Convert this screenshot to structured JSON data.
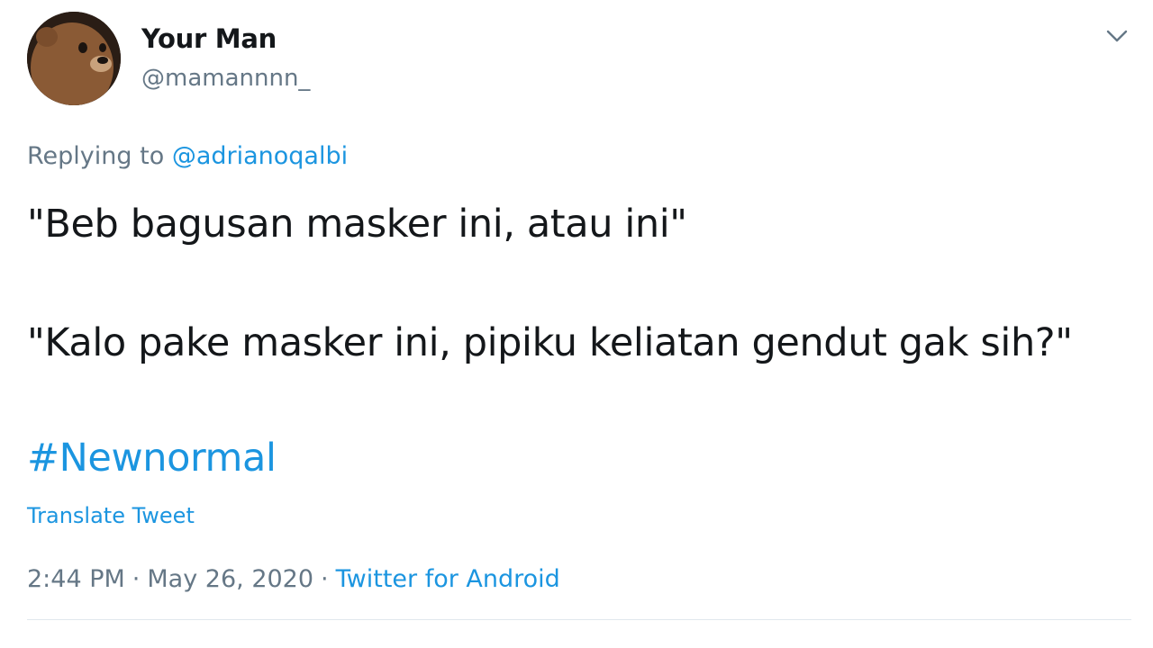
{
  "author": {
    "name": "Your Man",
    "handle": "@mamannnn_",
    "avatar_icon": "bear-avatar-icon"
  },
  "menu": {
    "icon": "chevron-down-icon"
  },
  "reply": {
    "prefix": "Replying to",
    "mention": "@adrianoqalbi"
  },
  "body": {
    "line1": "\"Beb bagusan masker ini, atau ini\"",
    "line2": "\"Kalo pake masker ini, pipiku keliatan gendut gak sih?\"",
    "hashtag": "#Newnormal"
  },
  "translate_label": "Translate Tweet",
  "meta": {
    "time": "2:44 PM",
    "separator": "·",
    "date": "May 26, 2020",
    "source": "Twitter for Android"
  },
  "colors": {
    "link": "#1b95e0",
    "muted": "#657786",
    "text": "#14171a"
  }
}
